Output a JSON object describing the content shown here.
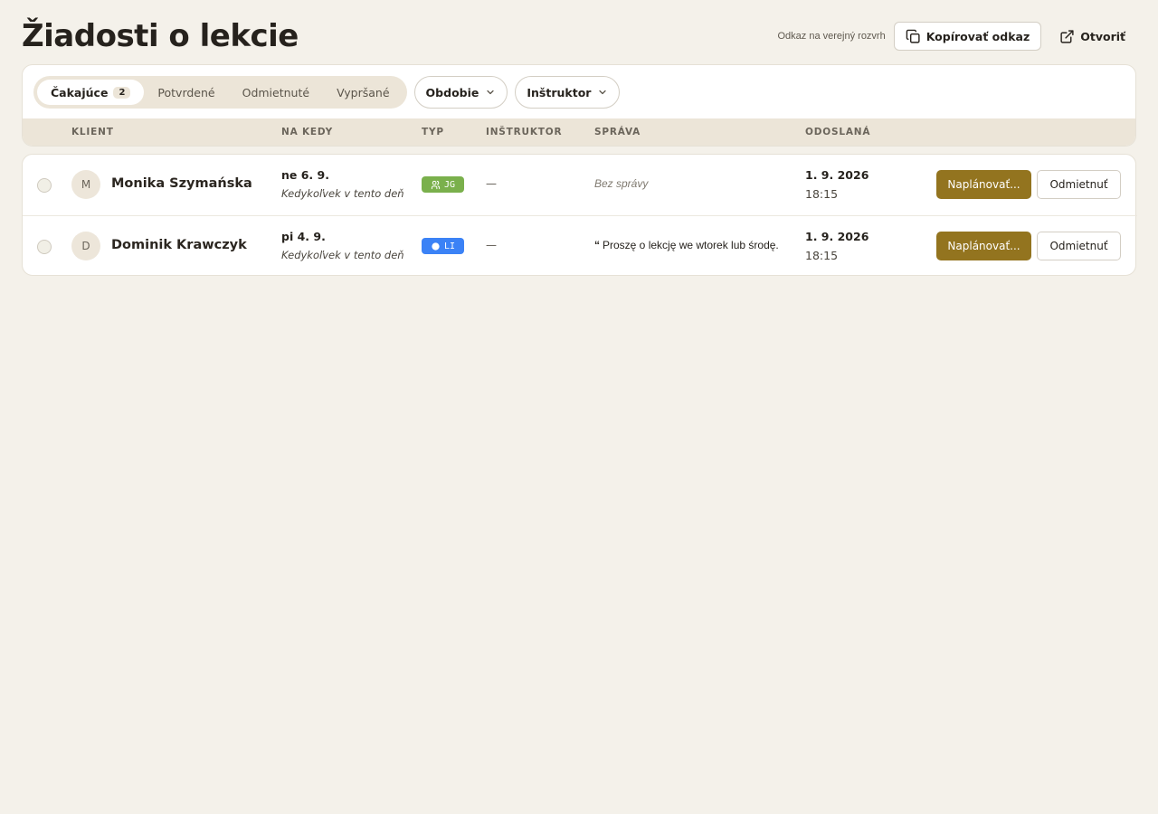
{
  "page": {
    "title": "Žiadosti o lekcie"
  },
  "header": {
    "share_label": "Odkaz na verejný rozvrh",
    "copy_label": "Kopírovať odkaz",
    "open_label": "Otvoriť"
  },
  "filters": {
    "tabs": [
      {
        "label": "Čakajúce",
        "count": "2",
        "active": true
      },
      {
        "label": "Potvrdené"
      },
      {
        "label": "Odmietnuté"
      },
      {
        "label": "Vypršané"
      }
    ],
    "period_label": "Obdobie",
    "instructor_label": "Inštruktor"
  },
  "table": {
    "headers": {
      "client": "KLIENT",
      "when": "NA KEDY",
      "type": "TYP",
      "instructor": "INŠTRUKTOR",
      "message": "SPRÁVA",
      "sent": "ODOSLANÁ"
    },
    "rows": [
      {
        "initial": "M",
        "name": "Monika Szymańska",
        "date": "ne 6. 9.",
        "note": "Kedykoľvek v tento deň",
        "type": "JG",
        "type_icon": "users-icon",
        "type_color": "#7ab04c",
        "instructor": "—",
        "message": "Bez správy",
        "sent_date": "1. 9. 2026",
        "sent_time": "18:15",
        "plan_label": "Naplánovať...",
        "decline_label": "Odmietnuť"
      },
      {
        "initial": "D",
        "name": "Dominik Krawczyk",
        "date": "pi 4. 9.",
        "note": "Kedykoľvek v tento deň",
        "type": "LI",
        "type_icon": "circle-icon",
        "type_color": "#3b82f6",
        "instructor": "—",
        "message_quote": "“",
        "message": "Proszę o lekcję we wtorek lub środę.",
        "sent_date": "1. 9. 2026",
        "sent_time": "18:15",
        "plan_label": "Naplánovať...",
        "decline_label": "Odmietnuť"
      }
    ]
  }
}
